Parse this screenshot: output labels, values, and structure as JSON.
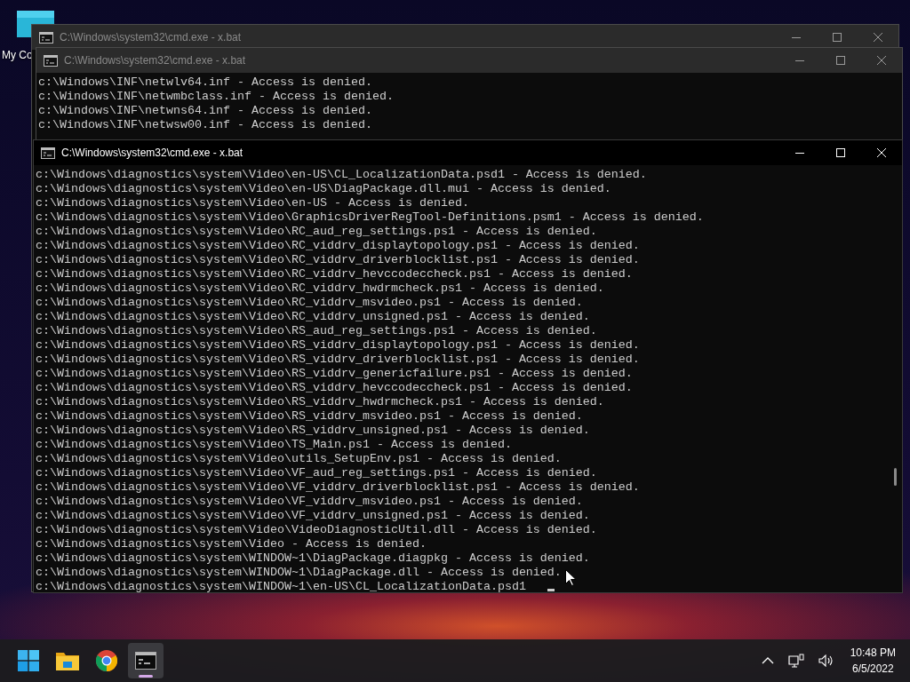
{
  "desktop": {
    "icons": [
      {
        "label": "My Co"
      }
    ]
  },
  "windows": [
    {
      "title": "C:\\Windows\\system32\\cmd.exe - x.bat",
      "active": false
    },
    {
      "title": "C:\\Windows\\system32\\cmd.exe - x.bat",
      "active": false,
      "lines": [
        "c:\\Windows\\INF\\netwlv64.inf - Access is denied.",
        "c:\\Windows\\INF\\netwmbclass.inf - Access is denied.",
        "c:\\Windows\\INF\\netwns64.inf - Access is denied.",
        "c:\\Windows\\INF\\netwsw00.inf - Access is denied."
      ]
    },
    {
      "title": "C:\\Windows\\system32\\cmd.exe - x.bat",
      "active": true,
      "lines": [
        "c:\\Windows\\diagnostics\\system\\Video\\en-US\\CL_LocalizationData.psd1 - Access is denied.",
        "c:\\Windows\\diagnostics\\system\\Video\\en-US\\DiagPackage.dll.mui - Access is denied.",
        "c:\\Windows\\diagnostics\\system\\Video\\en-US - Access is denied.",
        "c:\\Windows\\diagnostics\\system\\Video\\GraphicsDriverRegTool-Definitions.psm1 - Access is denied.",
        "c:\\Windows\\diagnostics\\system\\Video\\RC_aud_reg_settings.ps1 - Access is denied.",
        "c:\\Windows\\diagnostics\\system\\Video\\RC_viddrv_displaytopology.ps1 - Access is denied.",
        "c:\\Windows\\diagnostics\\system\\Video\\RC_viddrv_driverblocklist.ps1 - Access is denied.",
        "c:\\Windows\\diagnostics\\system\\Video\\RC_viddrv_hevccodeccheck.ps1 - Access is denied.",
        "c:\\Windows\\diagnostics\\system\\Video\\RC_viddrv_hwdrmcheck.ps1 - Access is denied.",
        "c:\\Windows\\diagnostics\\system\\Video\\RC_viddrv_msvideo.ps1 - Access is denied.",
        "c:\\Windows\\diagnostics\\system\\Video\\RC_viddrv_unsigned.ps1 - Access is denied.",
        "c:\\Windows\\diagnostics\\system\\Video\\RS_aud_reg_settings.ps1 - Access is denied.",
        "c:\\Windows\\diagnostics\\system\\Video\\RS_viddrv_displaytopology.ps1 - Access is denied.",
        "c:\\Windows\\diagnostics\\system\\Video\\RS_viddrv_driverblocklist.ps1 - Access is denied.",
        "c:\\Windows\\diagnostics\\system\\Video\\RS_viddrv_genericfailure.ps1 - Access is denied.",
        "c:\\Windows\\diagnostics\\system\\Video\\RS_viddrv_hevccodeccheck.ps1 - Access is denied.",
        "c:\\Windows\\diagnostics\\system\\Video\\RS_viddrv_hwdrmcheck.ps1 - Access is denied.",
        "c:\\Windows\\diagnostics\\system\\Video\\RS_viddrv_msvideo.ps1 - Access is denied.",
        "c:\\Windows\\diagnostics\\system\\Video\\RS_viddrv_unsigned.ps1 - Access is denied.",
        "c:\\Windows\\diagnostics\\system\\Video\\TS_Main.ps1 - Access is denied.",
        "c:\\Windows\\diagnostics\\system\\Video\\utils_SetupEnv.ps1 - Access is denied.",
        "c:\\Windows\\diagnostics\\system\\Video\\VF_aud_reg_settings.ps1 - Access is denied.",
        "c:\\Windows\\diagnostics\\system\\Video\\VF_viddrv_driverblocklist.ps1 - Access is denied.",
        "c:\\Windows\\diagnostics\\system\\Video\\VF_viddrv_msvideo.ps1 - Access is denied.",
        "c:\\Windows\\diagnostics\\system\\Video\\VF_viddrv_unsigned.ps1 - Access is denied.",
        "c:\\Windows\\diagnostics\\system\\Video\\VideoDiagnosticUtil.dll - Access is denied.",
        "c:\\Windows\\diagnostics\\system\\Video - Access is denied.",
        "c:\\Windows\\diagnostics\\system\\WINDOW~1\\DiagPackage.diagpkg - Access is denied.",
        "c:\\Windows\\diagnostics\\system\\WINDOW~1\\DiagPackage.dll - Access is denied.",
        "c:\\Windows\\diagnostics\\system\\WINDOW~1\\en-US\\CL_LocalizationData.psd1"
      ]
    }
  ],
  "taskbar": {
    "apps": [
      {
        "kind": "start",
        "selected": false
      },
      {
        "kind": "explorer",
        "selected": false
      },
      {
        "kind": "browser",
        "selected": false
      },
      {
        "kind": "terminal",
        "selected": true
      }
    ],
    "clock": {
      "time": "10:48 PM",
      "date": "6/5/2022"
    }
  }
}
